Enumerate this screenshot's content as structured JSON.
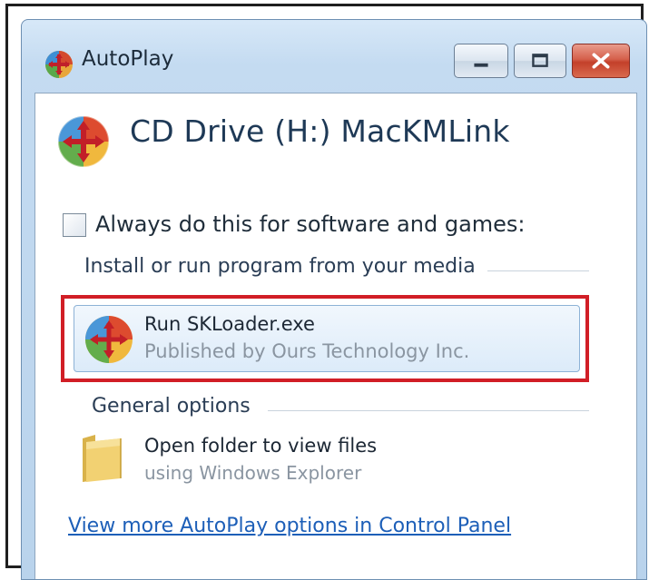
{
  "window": {
    "title": "AutoPlay",
    "minimize_icon": "minimize-icon",
    "maximize_icon": "maximize-icon",
    "close_icon": "close-icon"
  },
  "device": {
    "title": "CD Drive (H:) MacKMLink",
    "icon": "autoplay-disc-icon"
  },
  "always_checkbox": {
    "label": "Always do this for software and games:",
    "checked": false
  },
  "install_section": {
    "heading": "Install or run program from your media",
    "option": {
      "title": "Run SKLoader.exe",
      "subtitle": "Published by Ours Technology Inc.",
      "icon": "autoplay-program-icon",
      "highlight_color": "#d11e26"
    }
  },
  "general_section": {
    "heading": "General options",
    "option": {
      "title": "Open folder to view files",
      "subtitle": "using Windows Explorer",
      "icon": "folder-icon"
    }
  },
  "footer": {
    "link": "View more AutoPlay options in Control Panel"
  }
}
